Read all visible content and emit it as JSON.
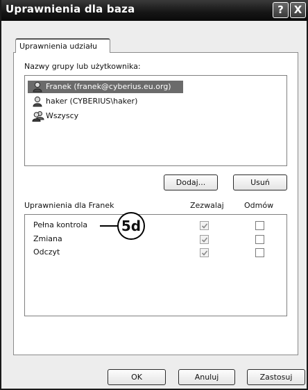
{
  "window": {
    "title": "Uprawnienia dla baza",
    "help_label": "?",
    "close_label": "X"
  },
  "tabs": [
    {
      "label": "Uprawnienia udziału",
      "active": true
    }
  ],
  "users_section": {
    "label": "Nazwy grupy lub użytkownika:",
    "items": [
      {
        "label": "Franek (franek@cyberius.eu.org)",
        "selected": true,
        "icon": "user-icon"
      },
      {
        "label": "haker (CYBERIUS\\haker)",
        "selected": false,
        "icon": "user-icon"
      },
      {
        "label": "Wszyscy",
        "selected": false,
        "icon": "users-group-icon"
      }
    ],
    "add_button": "Dodaj...",
    "remove_button": "Usuń"
  },
  "permissions_section": {
    "label": "Uprawnienia dla Franek",
    "allow_header": "Zezwalaj",
    "deny_header": "Odmów",
    "rows": [
      {
        "label": "Pełna kontrola",
        "allow": true,
        "deny": false
      },
      {
        "label": "Zmiana",
        "allow": true,
        "deny": false
      },
      {
        "label": "Odczyt",
        "allow": true,
        "deny": false
      }
    ]
  },
  "annotation": {
    "label": "5d"
  },
  "footer": {
    "ok_label": "OK",
    "cancel_label": "Anuluj",
    "apply_label": "Zastosuj"
  },
  "colors": {
    "selection": "#6b6b6b",
    "titlebar": "#151515"
  }
}
